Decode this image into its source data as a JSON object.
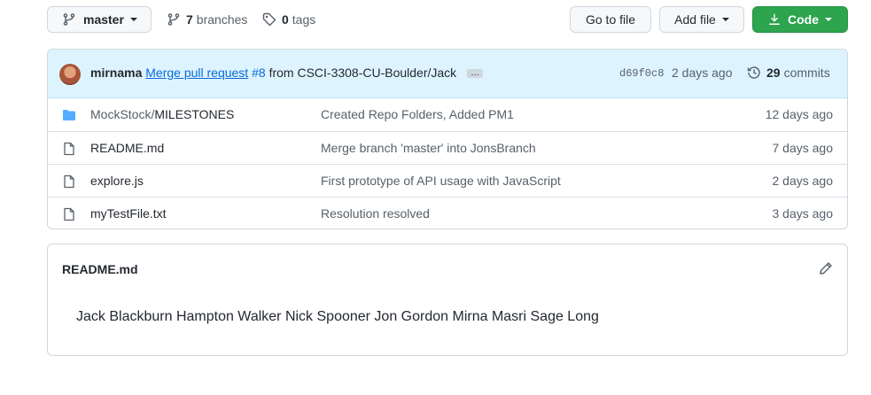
{
  "toolbar": {
    "branch": "master",
    "branches_count": "7",
    "branches_label": "branches",
    "tags_count": "0",
    "tags_label": "tags",
    "goto_label": "Go to file",
    "add_file_label": "Add file",
    "code_label": "Code"
  },
  "commit": {
    "author": "mirnama",
    "message_link": "Merge pull request",
    "pr_number": "#8",
    "message_rest": "from CSCI-3308-CU-Boulder/Jack",
    "ellipsis": "…",
    "sha": "d69f0c8",
    "ago": "2 days ago",
    "commits_count": "29",
    "commits_label": "commits"
  },
  "files": [
    {
      "type": "folder",
      "name_prefix": "MockStock/",
      "name": "MILESTONES",
      "message": "Created Repo Folders, Added PM1",
      "age": "12 days ago"
    },
    {
      "type": "file",
      "name_prefix": "",
      "name": "README.md",
      "message": "Merge branch 'master' into JonsBranch",
      "age": "7 days ago"
    },
    {
      "type": "file",
      "name_prefix": "",
      "name": "explore.js",
      "message": "First prototype of API usage with JavaScript",
      "age": "2 days ago"
    },
    {
      "type": "file",
      "name_prefix": "",
      "name": "myTestFile.txt",
      "message": "Resolution resolved",
      "age": "3 days ago"
    }
  ],
  "readme": {
    "title": "README.md",
    "content": "Jack Blackburn Hampton Walker Nick Spooner Jon Gordon Mirna Masri Sage Long"
  },
  "colors": {
    "accent": "#0969da",
    "primary_button": "#2da44e",
    "commit_bar": "#ddf4ff",
    "folder": "#54aeff"
  }
}
